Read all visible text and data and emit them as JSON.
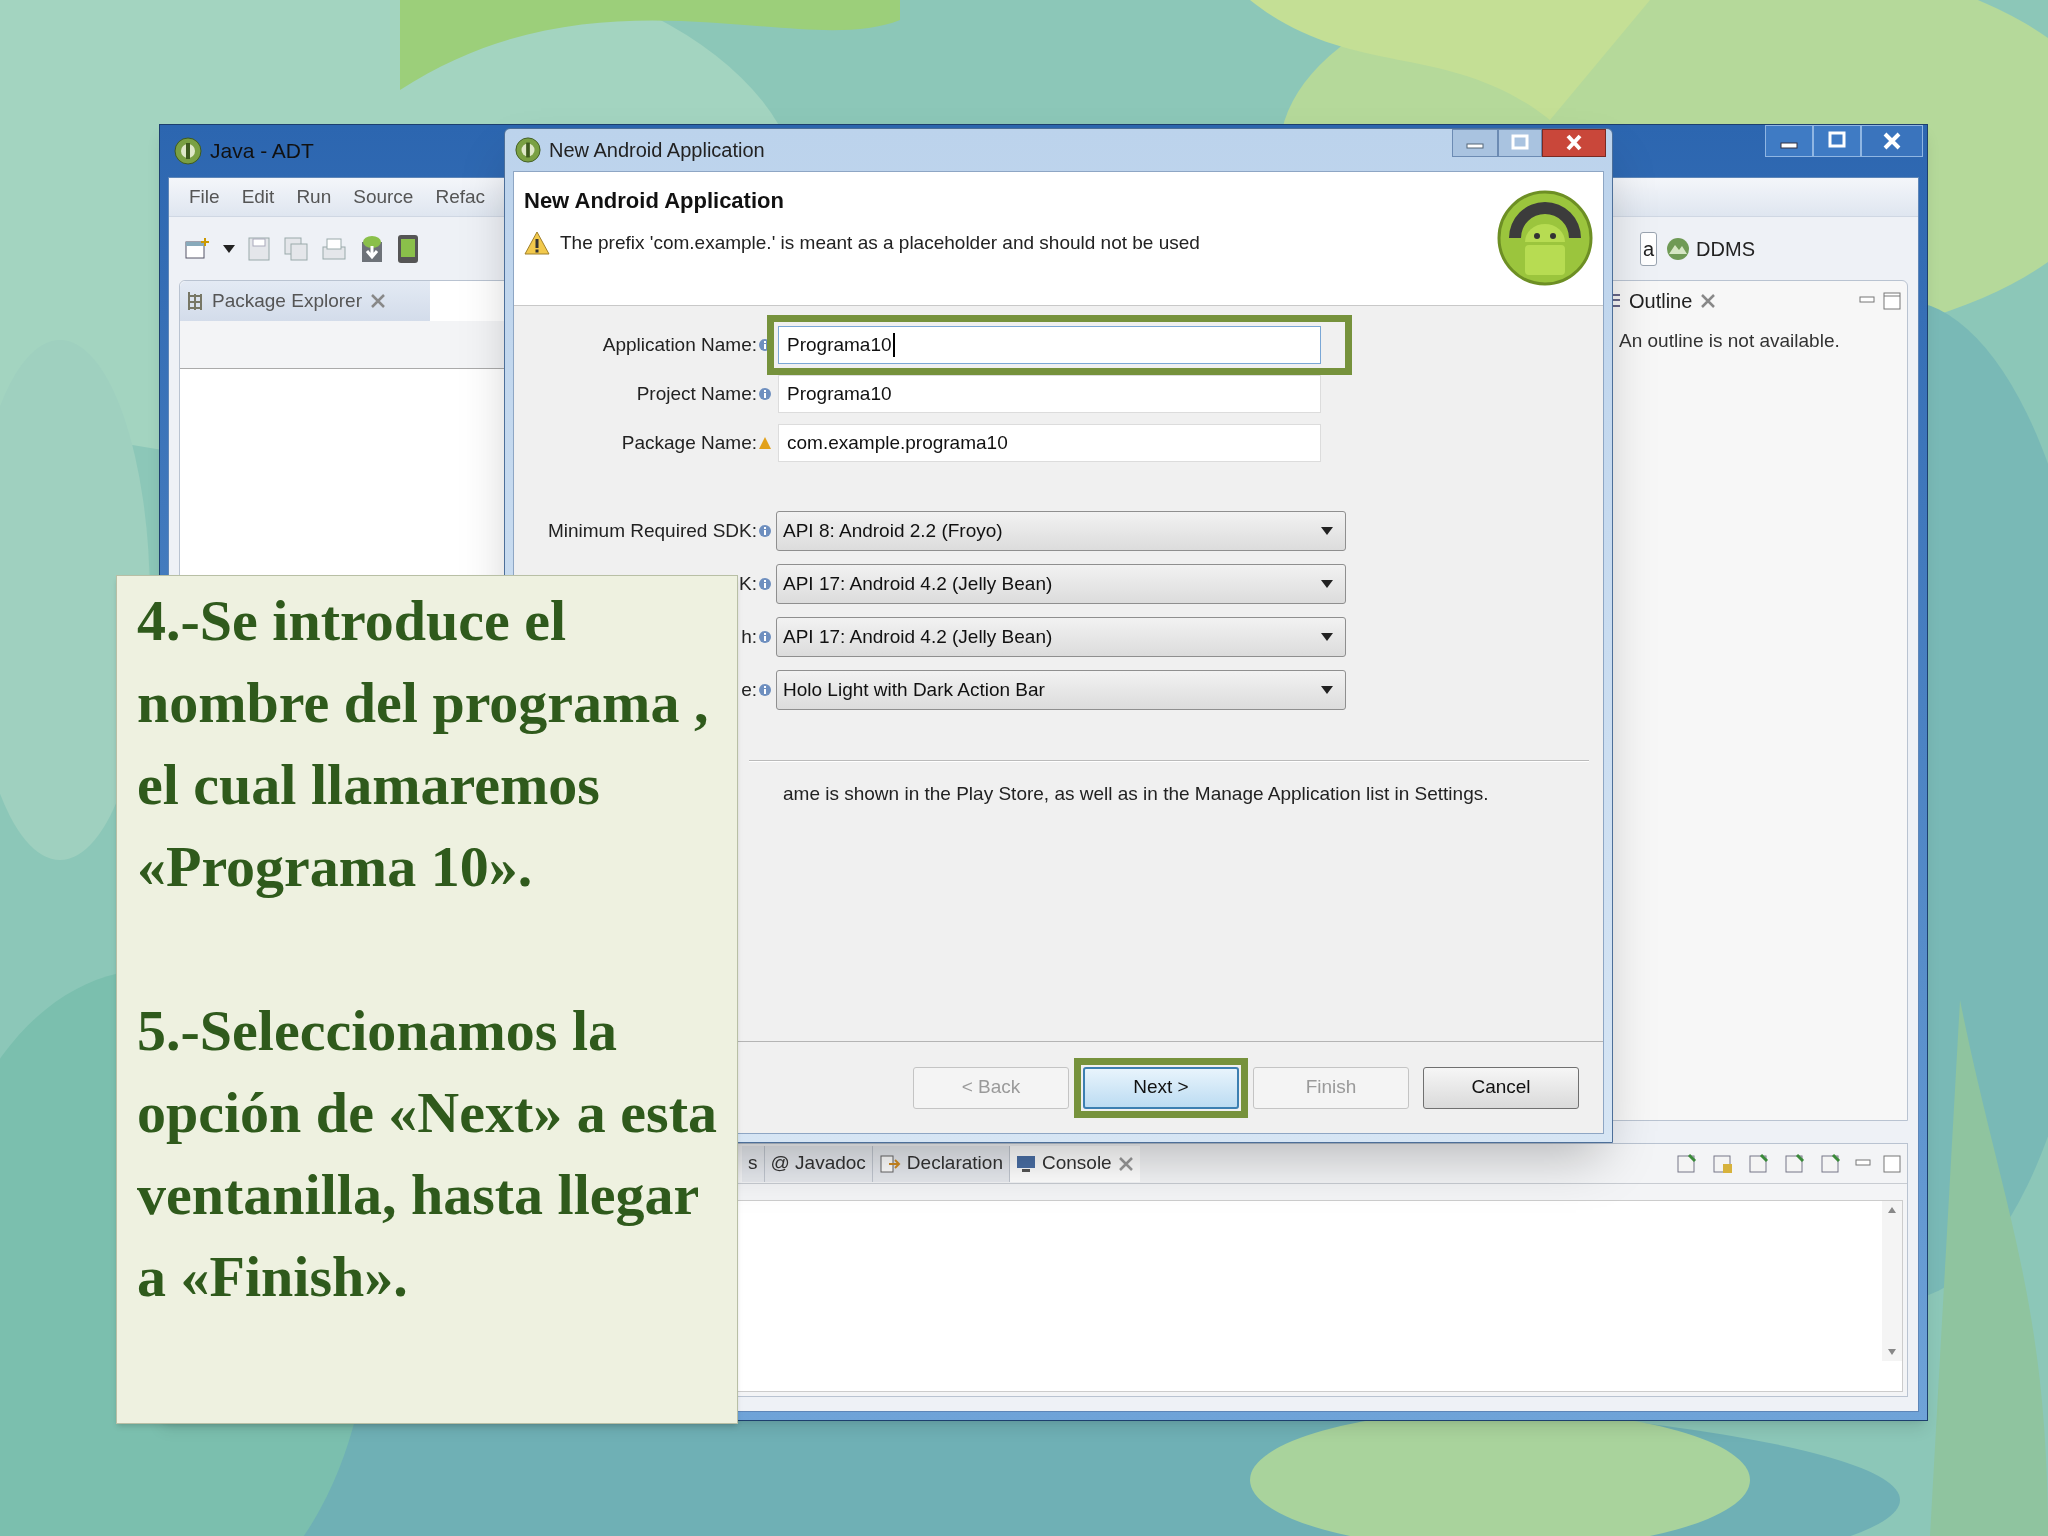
{
  "ide_window": {
    "title": "Java - ADT",
    "menu": [
      "File",
      "Edit",
      "Run",
      "Source",
      "Refac"
    ],
    "perspectives": [
      {
        "label": "a",
        "selected": true
      },
      {
        "label": "DDMS",
        "selected": false
      }
    ],
    "left_view_tab": "Package Explorer",
    "right_view_tab": "Outline",
    "right_view_message": "An outline is not available.",
    "bottom_tabs": [
      {
        "label": "s",
        "selected": false
      },
      {
        "label": "@ Javadoc",
        "selected": false
      },
      {
        "label": "Declaration",
        "selected": false
      },
      {
        "label": "Console",
        "selected": true
      }
    ]
  },
  "dialog": {
    "title": "New Android Application",
    "heading": "New Android Application",
    "warning": "The prefix 'com.example.' is meant as a placeholder and should not be used",
    "text_fields": [
      {
        "label": "Application Name:",
        "kind": "info",
        "value": "Programa10",
        "focused": true,
        "highlighted": true
      },
      {
        "label": "Project Name:",
        "kind": "info",
        "value": "Programa10",
        "focused": false,
        "highlighted": false
      },
      {
        "label": "Package Name:",
        "kind": "warning",
        "value": "com.example.programa10",
        "focused": false,
        "highlighted": false
      }
    ],
    "dropdowns": [
      {
        "label": "Minimum Required SDK:",
        "value": "API 8: Android 2.2 (Froyo)"
      },
      {
        "label": "K:",
        "value": "API 17: Android 4.2 (Jelly Bean)"
      },
      {
        "label": "h:",
        "value": "API 17: Android 4.2 (Jelly Bean)"
      },
      {
        "label": "e:",
        "value": "Holo Light with Dark Action Bar"
      }
    ],
    "description": "ame is shown in the Play Store, as well as in the Manage Application list in Settings.",
    "buttons": [
      {
        "label": "< Back",
        "disabled": true,
        "default": false,
        "highlighted": false
      },
      {
        "label": "Next >",
        "disabled": false,
        "default": true,
        "highlighted": true
      },
      {
        "label": "Finish",
        "disabled": true,
        "default": false,
        "highlighted": false
      },
      {
        "label": "Cancel",
        "disabled": false,
        "default": false,
        "highlighted": false
      }
    ]
  },
  "caption": {
    "paragraphs": [
      "4.-Se introduce el nombre del programa , el cual llamaremos «Programa 10».",
      "5.-Seleccionamos la opción de «Next» a esta ventanilla, hasta llegar a «Finish»."
    ]
  }
}
